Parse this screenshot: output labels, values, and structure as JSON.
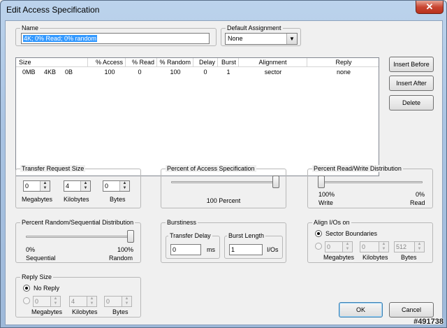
{
  "window": {
    "title": "Edit Access Specification",
    "close_glyph": "✕"
  },
  "name": {
    "label": "Name",
    "value": "4K; 0% Read; 0% random"
  },
  "default_assignment": {
    "label": "Default Assignment",
    "value": "None",
    "arrow": "▼"
  },
  "list": {
    "columns": [
      "Size",
      "% Access",
      "% Read",
      "% Random",
      "Delay",
      "Burst",
      "Alignment",
      "Reply"
    ],
    "rows": [
      {
        "size_mb": "0MB",
        "size_kb": "4KB",
        "size_b": "0B",
        "access": "100",
        "read": "0",
        "random": "100",
        "delay": "0",
        "burst": "1",
        "alignment": "sector",
        "reply": "none"
      }
    ]
  },
  "side_buttons": {
    "insert_before": "Insert Before",
    "insert_after": "Insert After",
    "delete": "Delete"
  },
  "transfer_size": {
    "label": "Transfer Request Size",
    "megabytes": "0",
    "kilobytes": "4",
    "bytes": "0",
    "megabytes_label": "Megabytes",
    "kilobytes_label": "Kilobytes",
    "bytes_label": "Bytes"
  },
  "percent_access": {
    "label": "Percent of Access Specification",
    "caption": "100 Percent",
    "value": 100
  },
  "percent_read": {
    "label": "Percent Read/Write Distribution",
    "left_value": "100%",
    "left_label": "Write",
    "right_value": "0%",
    "right_label": "Read",
    "read_percent": 0
  },
  "percent_random": {
    "label": "Percent Random/Sequential Distribution",
    "left_value": "0%",
    "left_label": "Sequential",
    "right_value": "100%",
    "right_label": "Random",
    "random_percent": 100
  },
  "burstiness": {
    "label": "Burstiness",
    "delay_label": "Transfer Delay",
    "delay_value": "0",
    "delay_unit": "ms",
    "burst_label": "Burst Length",
    "burst_value": "1",
    "burst_unit": "I/Os"
  },
  "align": {
    "label": "Align I/Os on",
    "sector_label": "Sector Boundaries",
    "megabytes": "0",
    "kilobytes": "0",
    "bytes": "512",
    "megabytes_label": "Megabytes",
    "kilobytes_label": "Kilobytes",
    "bytes_label": "Bytes"
  },
  "reply": {
    "label": "Reply Size",
    "no_reply_label": "No Reply",
    "megabytes": "0",
    "kilobytes": "4",
    "bytes": "0",
    "megabytes_label": "Megabytes",
    "kilobytes_label": "Kilobytes",
    "bytes_label": "Bytes"
  },
  "buttons": {
    "ok": "OK",
    "cancel": "Cancel"
  },
  "watermark": "#491738",
  "spin_up": "▲",
  "spin_down": "▼"
}
